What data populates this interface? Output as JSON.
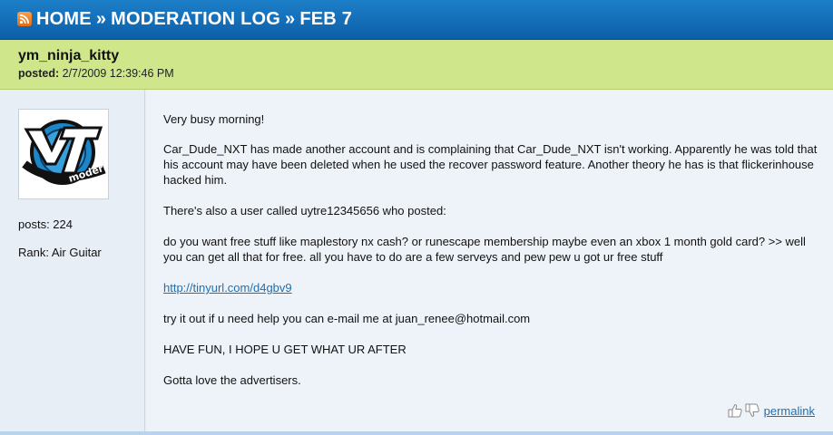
{
  "breadcrumb": {
    "home": "HOME",
    "separator": "»",
    "section": "MODERATION LOG",
    "page": "FEB 7"
  },
  "post": {
    "username": "ym_ninja_kitty",
    "posted_label": "posted:",
    "posted_value": "2/7/2009 12:39:46 PM"
  },
  "author": {
    "avatar_text": "moderator",
    "posts": "posts: 224",
    "rank": "Rank: Air Guitar"
  },
  "message": {
    "p1": "Very busy morning!",
    "p2": "Car_Dude_NXT has made another account and is complaining that Car_Dude_NXT isn't working. Apparently he was told that his account may have been deleted when he used the recover password feature. Another theory he has is that flickerinhouse hacked him.",
    "p3": "There's also a user called uytre12345656 who posted:",
    "p4": "do you want free stuff like maplestory nx cash? or runescape membership maybe even an xbox 1 month gold card? >> well you can get all that for free. all you have to do are a few serveys and pew pew u got ur free stuff",
    "link": "http://tinyurl.com/d4gbv9",
    "p5": "try it out if u need help you can e-mail me at juan_renee@hotmail.com",
    "p6": "HAVE FUN, I HOPE U GET WHAT UR AFTER",
    "p7": "Gotta love the advertisers."
  },
  "actions": {
    "permalink": "permalink"
  },
  "colors": {
    "header_blue": "#1373bd",
    "post_header_green": "#cfe78a",
    "link_blue": "#1f6fb0"
  }
}
